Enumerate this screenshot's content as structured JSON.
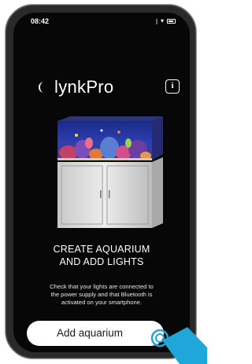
{
  "status_bar": {
    "time": "08:42"
  },
  "brand": {
    "name": "lynkPro"
  },
  "info_button": {
    "label": "i"
  },
  "headline": {
    "line1": "CREATE AQUARIUM",
    "line2": "AND ADD LIGHTS"
  },
  "instructions": {
    "line1": "Check that your lights are connected to",
    "line2": "the power supply and that Bluetooth is",
    "line3": "activated on your smartphone."
  },
  "primary_action": {
    "label": "Add aquarium"
  },
  "icons": {
    "logo_mark": "crescent-logo-icon",
    "info": "info-icon",
    "tap": "tap-gesture-icon"
  },
  "colors": {
    "screen_background": "#070707",
    "text": "#ffffff",
    "button_background": "#ffffff",
    "tap_accent": "#1ea7d8"
  }
}
